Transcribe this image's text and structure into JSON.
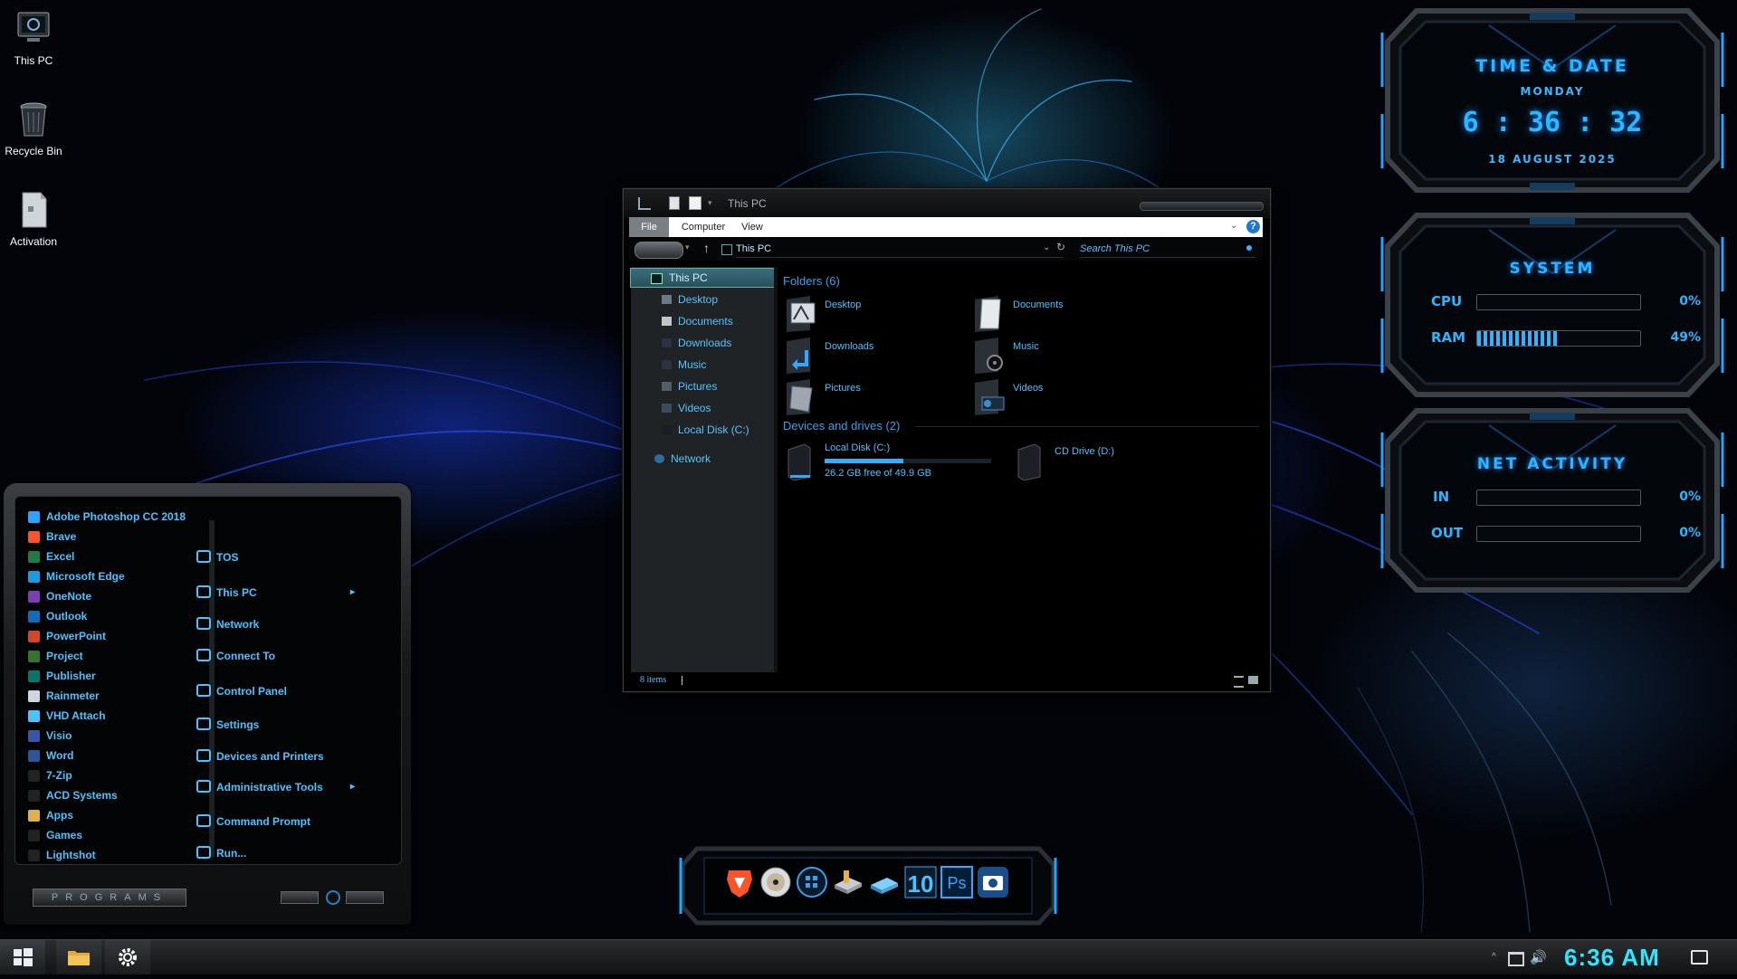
{
  "desktop": {
    "icons": [
      {
        "label": "This PC",
        "icon": "computer-icon"
      },
      {
        "label": "Recycle Bin",
        "icon": "recycle-bin-icon"
      },
      {
        "label": "Activation",
        "icon": "document-icon"
      }
    ]
  },
  "widgets": {
    "time_date": {
      "title": "TIME & DATE",
      "day": "MONDAY",
      "hour": "6",
      "sep": ":",
      "minute": "36",
      "second": "32",
      "date": "18 AUGUST 2025"
    },
    "system": {
      "title": "SYSTEM",
      "cpu_label": "CPU",
      "cpu_value": "0%",
      "cpu_fraction": 0.0,
      "ram_label": "RAM",
      "ram_value": "49%",
      "ram_fraction": 0.49
    },
    "net": {
      "title": "NET ACTIVITY",
      "in_label": "IN",
      "in_value": "0%",
      "in_fraction": 0.0,
      "out_label": "OUT",
      "out_value": "0%",
      "out_fraction": 0.0
    },
    "accent": "#29b6ff"
  },
  "explorer": {
    "title": "This PC",
    "ribbon_tabs": [
      "File",
      "Computer",
      "View"
    ],
    "address": "This PC",
    "search_placeholder": "Search This PC",
    "nav": [
      {
        "label": "This PC",
        "icon": "computer-icon",
        "selected": true
      },
      {
        "label": "Desktop",
        "icon": "desktop-icon"
      },
      {
        "label": "Documents",
        "icon": "document-icon"
      },
      {
        "label": "Downloads",
        "icon": "download-icon"
      },
      {
        "label": "Music",
        "icon": "music-icon"
      },
      {
        "label": "Pictures",
        "icon": "pictures-icon"
      },
      {
        "label": "Videos",
        "icon": "video-icon"
      },
      {
        "label": "Local Disk (C:)",
        "icon": "drive-icon"
      },
      {
        "label": "Network",
        "icon": "network-icon"
      }
    ],
    "folders_title": "Folders (6)",
    "folders": [
      "Desktop",
      "Documents",
      "Downloads",
      "Music",
      "Pictures",
      "Videos"
    ],
    "drives_title": "Devices and drives (2)",
    "drives": [
      {
        "name": "Local Disk (C:)",
        "free": "26.2 GB free of 49.9 GB",
        "used_fraction": 0.475
      },
      {
        "name": "CD Drive (D:)"
      }
    ],
    "status": "8 items",
    "accent": "#4cc2ff"
  },
  "start_menu": {
    "programs": [
      {
        "label": "Adobe Photoshop CC 2018",
        "color": "#2fa3ff"
      },
      {
        "label": "Brave",
        "color": "#fb542b"
      },
      {
        "label": "Excel",
        "color": "#1f7a45"
      },
      {
        "label": "Microsoft Edge",
        "color": "#1e9be0"
      },
      {
        "label": "OneNote",
        "color": "#7b3fb2"
      },
      {
        "label": "Outlook",
        "color": "#0f6cbd"
      },
      {
        "label": "PowerPoint",
        "color": "#d24726"
      },
      {
        "label": "Project",
        "color": "#31752f"
      },
      {
        "label": "Publisher",
        "color": "#077568"
      },
      {
        "label": "Rainmeter",
        "color": "#cfd6dd"
      },
      {
        "label": "VHD Attach",
        "color": "#4cc2ff"
      },
      {
        "label": "Visio",
        "color": "#3955a3"
      },
      {
        "label": "Word",
        "color": "#2b579a"
      },
      {
        "label": "7-Zip",
        "color": "#222222"
      },
      {
        "label": "ACD Systems",
        "color": "#222222"
      },
      {
        "label": "Apps",
        "color": "#e0b04a"
      },
      {
        "label": "Games",
        "color": "#222222"
      },
      {
        "label": "Lightshot",
        "color": "#222222"
      }
    ],
    "places": [
      {
        "label": "TOS",
        "icon": "user-icon"
      },
      {
        "label": "This PC",
        "icon": "computer-icon",
        "arrow": true
      },
      {
        "label": "Network",
        "icon": "network-icon"
      },
      {
        "label": "Connect To",
        "icon": "connect-icon"
      },
      {
        "label": "Control Panel",
        "icon": "control-panel-icon"
      },
      {
        "label": "Settings",
        "icon": "gear-icon"
      },
      {
        "label": "Devices and Printers",
        "icon": "printer-icon"
      },
      {
        "label": "Administrative Tools",
        "icon": "tools-icon",
        "arrow": true
      },
      {
        "label": "Command Prompt",
        "icon": "terminal-icon"
      },
      {
        "label": "Run...",
        "icon": "run-icon"
      }
    ],
    "programs_button": "PROGRAMS"
  },
  "dock": {
    "icons": [
      "brave-icon",
      "dvd-icon",
      "apps-icon",
      "drive-tools-icon",
      "usb-drive-icon",
      "windows-10-icon",
      "photoshop-icon",
      "camera-icon"
    ],
    "win10_text": "10",
    "ps_text": "Ps"
  },
  "taskbar": {
    "clock": "6:36 AM",
    "items": [
      "start-button",
      "file-explorer-icon",
      "settings-gear-icon"
    ]
  }
}
